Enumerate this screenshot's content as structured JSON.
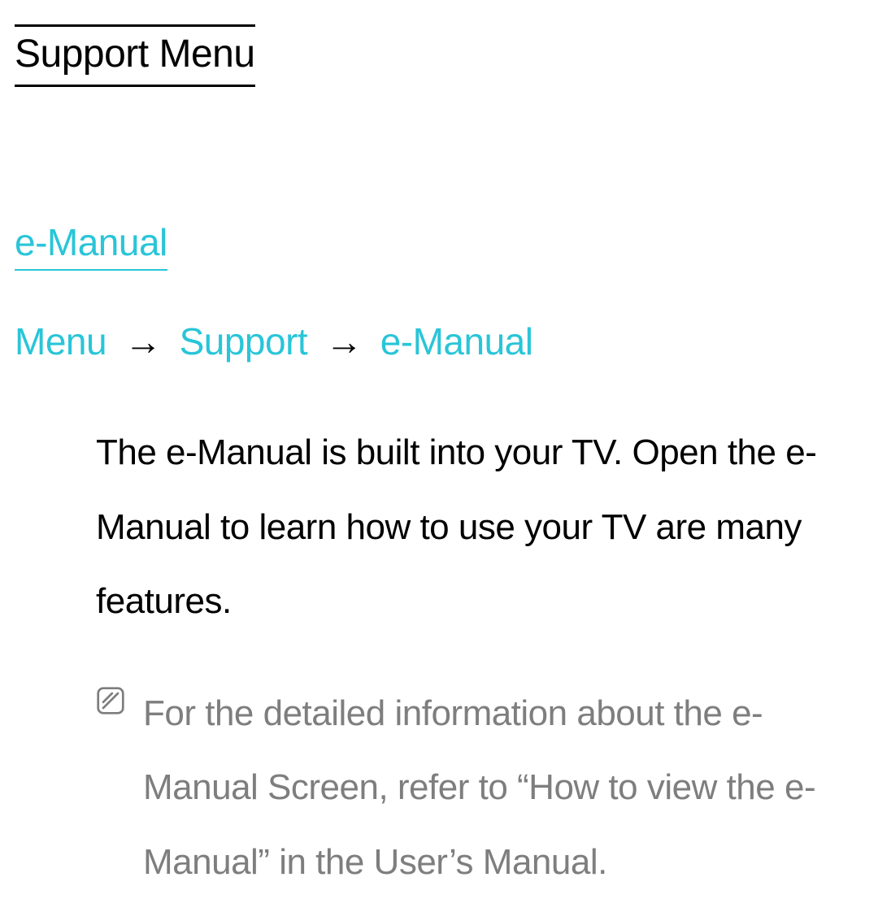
{
  "page": {
    "section_title": "Support Menu",
    "subheading": "e-Manual",
    "breadcrumb": {
      "segments": [
        "Menu",
        "Support",
        "e-Manual"
      ],
      "separator": "→"
    },
    "body_text": "The e-Manual is built into your TV. Open the e-Manual to learn how to use your TV are many features.",
    "note_text": "For the detailed information about the e-Manual Screen, refer to “How to view the e-Manual” in the User’s Manual."
  }
}
